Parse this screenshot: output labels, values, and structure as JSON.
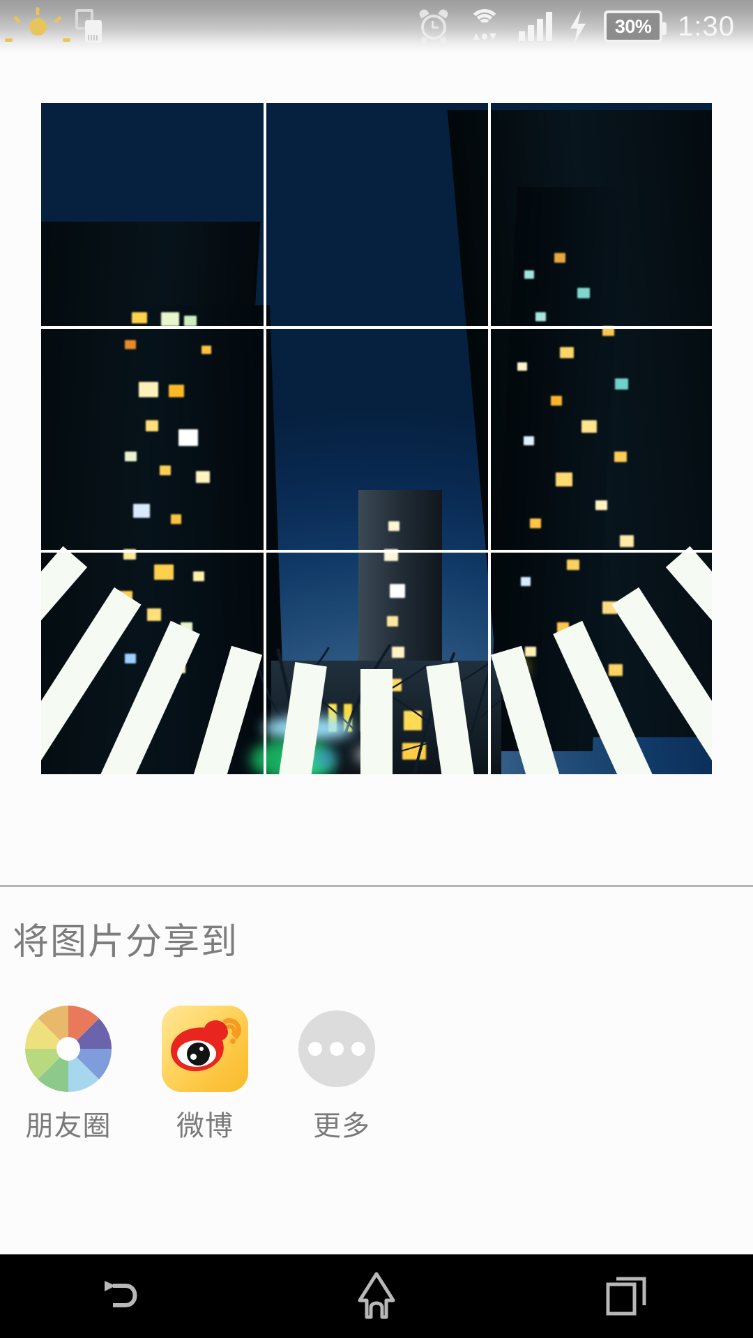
{
  "status_bar": {
    "time": "1:30",
    "battery_percent": "30%",
    "icons": [
      {
        "name": "brightness-sun-icon",
        "position": "left"
      },
      {
        "name": "usb-connected-icon",
        "position": "left"
      },
      {
        "name": "alarm-clock-icon",
        "position": "right"
      },
      {
        "name": "wifi-icon",
        "position": "right"
      },
      {
        "name": "cellular-signal-icon",
        "position": "right"
      },
      {
        "name": "charging-bolt-icon",
        "position": "right"
      },
      {
        "name": "battery-icon",
        "position": "right"
      }
    ]
  },
  "photo": {
    "description": "Night cityscape of apartment towers at dusk with radial white sunburst filter",
    "overlay": "rule-of-thirds-grid",
    "grid_rows": 3,
    "grid_cols": 3
  },
  "share": {
    "title": "将图片分享到",
    "targets": [
      {
        "label": "朋友圈",
        "icon": "wechat-moments-icon"
      },
      {
        "label": "微博",
        "icon": "weibo-icon"
      },
      {
        "label": "更多",
        "icon": "more-dots-icon"
      }
    ]
  },
  "nav_bar": {
    "buttons": [
      {
        "name": "back-button",
        "icon": "back-arrow-icon"
      },
      {
        "name": "home-button",
        "icon": "home-icon"
      },
      {
        "name": "recents-button",
        "icon": "recents-icon"
      }
    ]
  },
  "colors": {
    "panel_background": "#fcfcfc",
    "divider": "#b5b5b5",
    "label_text": "#7a7a7a",
    "title_text": "#7d7d7d",
    "nav_background": "#000000",
    "nav_icon": "#b8b8b8",
    "status_text": "#f7f7f7",
    "sun_accent": "#e8c55a",
    "weibo_red": "#e8251f",
    "weibo_yellow": "#ffd766",
    "more_circle": "#dcdcdc",
    "sky_blue": "#113a68"
  }
}
